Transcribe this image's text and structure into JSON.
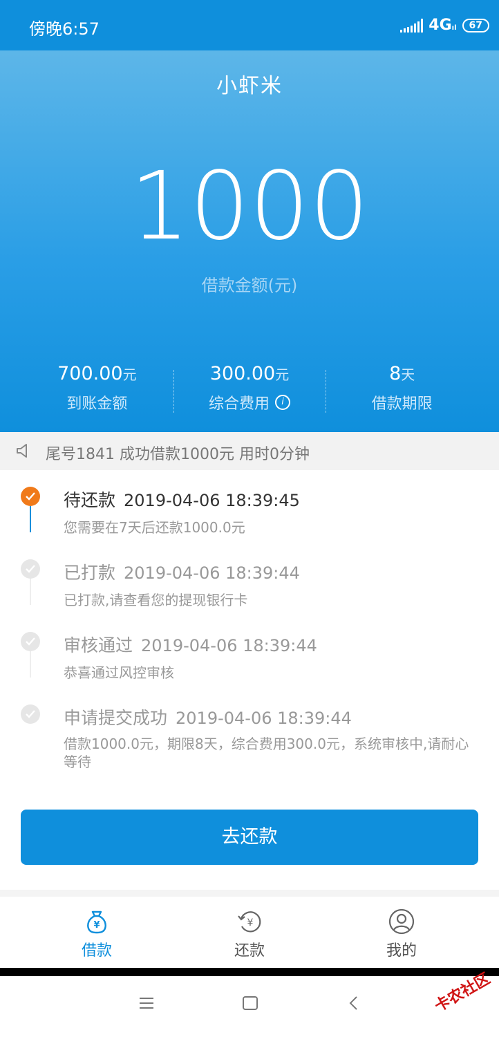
{
  "status_bar": {
    "time": "傍晚6:57",
    "network": "4G",
    "network_sub": "ıl",
    "battery": "67"
  },
  "app": {
    "title": "小虾米"
  },
  "loan": {
    "amount": "1000",
    "amount_label": "借款金额(元)",
    "stats": [
      {
        "value": "700.00",
        "unit": "元",
        "label": "到账金额"
      },
      {
        "value": "300.00",
        "unit": "元",
        "label": "综合费用",
        "icon": "info-icon"
      },
      {
        "value": "8",
        "unit": "天",
        "label": "借款期限"
      }
    ]
  },
  "notice": {
    "icon": "speaker-icon",
    "text": "尾号1841 成功借款1000元 用时0分钟"
  },
  "timeline": [
    {
      "title": "待还款",
      "time": "2019-04-06 18:39:45",
      "desc": "您需要在7天后还款1000.0元",
      "active": true
    },
    {
      "title": "已打款",
      "time": "2019-04-06 18:39:44",
      "desc": "已打款,请查看您的提现银行卡",
      "active": false
    },
    {
      "title": "审核通过",
      "time": "2019-04-06 18:39:44",
      "desc": "恭喜通过风控审核",
      "active": false
    },
    {
      "title": "申请提交成功",
      "time": "2019-04-06 18:39:44",
      "desc": "借款1000.0元，期限8天，综合费用300.0元，系统审核中,请耐心等待",
      "active": false
    }
  ],
  "repay_button": "去还款",
  "tabs": [
    {
      "label": "借款",
      "icon": "money-bag-icon",
      "active": true
    },
    {
      "label": "还款",
      "icon": "repay-cycle-icon",
      "active": false
    },
    {
      "label": "我的",
      "icon": "user-icon",
      "active": false
    }
  ],
  "watermark": "卡农社区",
  "colors": {
    "primary": "#0f8fdc",
    "active_step": "#f07a1a",
    "inactive_step": "#e6e6e6"
  }
}
